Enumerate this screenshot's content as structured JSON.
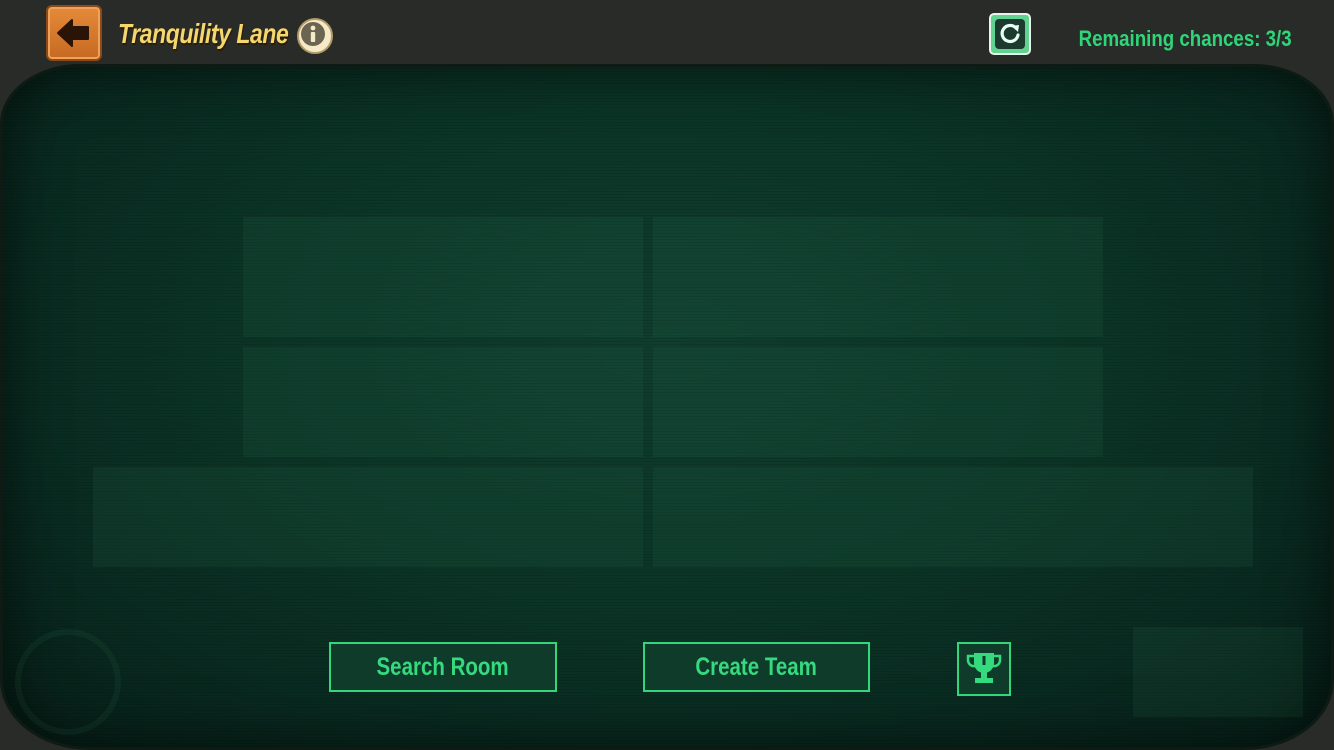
{
  "header": {
    "title": "Tranquility Lane",
    "remaining_chances": "Remaining chances: 3/3"
  },
  "actions": {
    "search_room_label": "Search Room",
    "create_team_label": "Create Team"
  },
  "icons": {
    "back": "back-arrow-icon",
    "info": "info-icon",
    "refresh": "refresh-icon",
    "leaderboard": "trophy-icon"
  },
  "colors": {
    "accent_green": "#35d97e",
    "title_yellow": "#f5d76e",
    "back_orange": "#d9792c",
    "panel_bg": "#0b3426"
  }
}
